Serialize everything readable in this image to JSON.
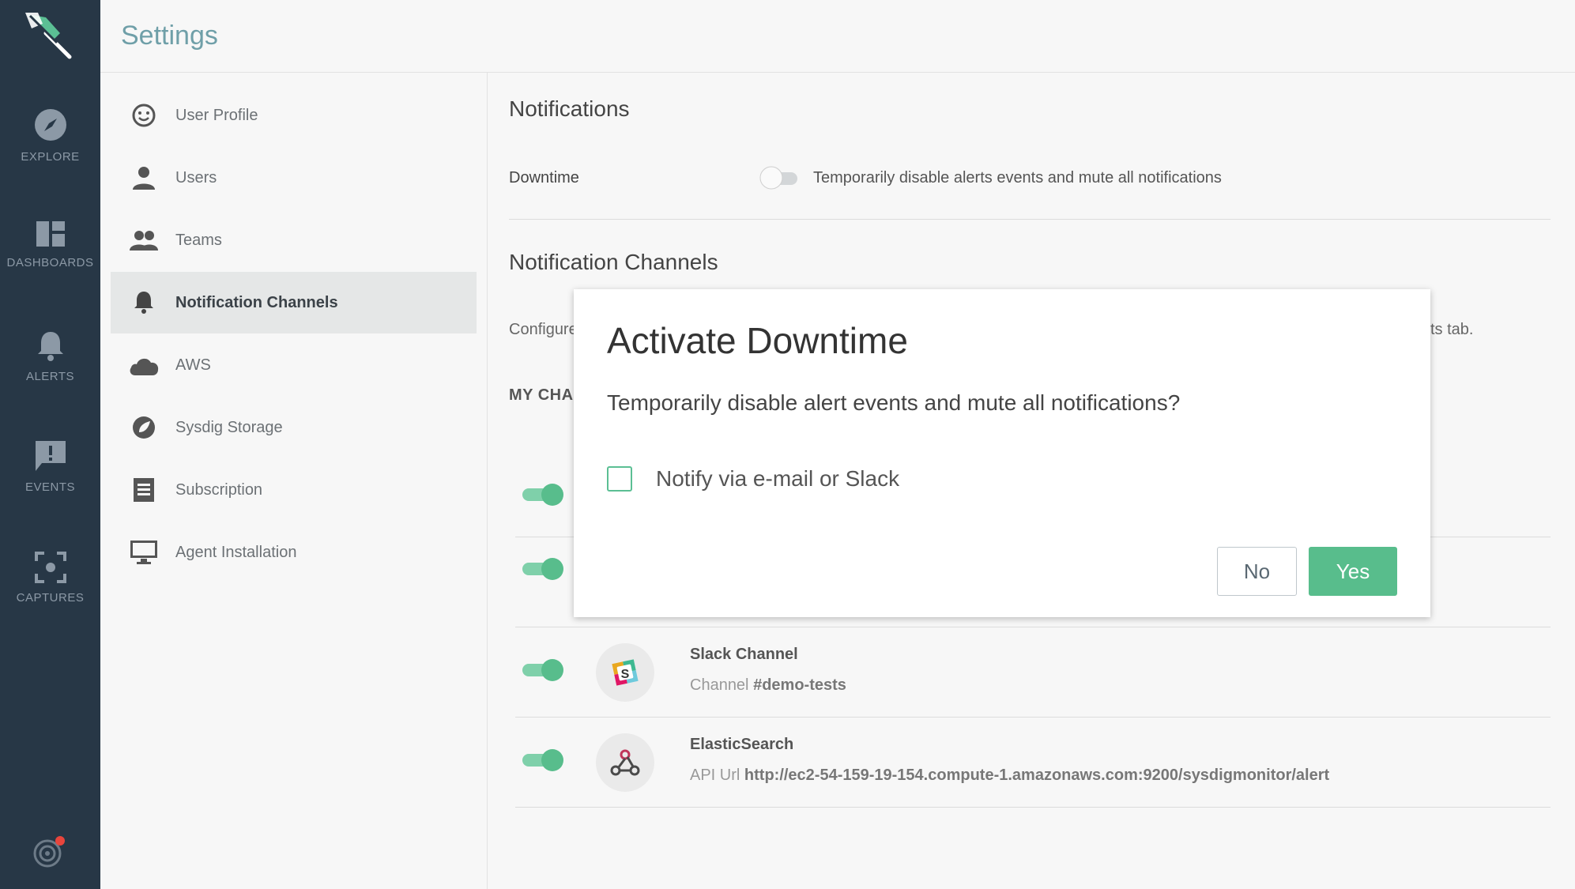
{
  "rail": {
    "items": [
      {
        "label": "EXPLORE",
        "icon": "compass-icon"
      },
      {
        "label": "DASHBOARDS",
        "icon": "dashboard-icon"
      },
      {
        "label": "ALERTS",
        "icon": "bell-icon"
      },
      {
        "label": "EVENTS",
        "icon": "exclamation-chat-icon"
      },
      {
        "label": "CAPTURES",
        "icon": "capture-icon"
      }
    ]
  },
  "header": {
    "title": "Settings"
  },
  "settings_nav": {
    "items": [
      {
        "label": "User Profile",
        "icon": "smiley-icon",
        "active": false
      },
      {
        "label": "Users",
        "icon": "person-icon",
        "active": false
      },
      {
        "label": "Teams",
        "icon": "people-icon",
        "active": false
      },
      {
        "label": "Notification Channels",
        "icon": "bell-icon",
        "active": true
      },
      {
        "label": "AWS",
        "icon": "cloud-icon",
        "active": false
      },
      {
        "label": "Sysdig Storage",
        "icon": "storage-icon",
        "active": false
      },
      {
        "label": "Subscription",
        "icon": "receipt-icon",
        "active": false
      },
      {
        "label": "Agent Installation",
        "icon": "monitor-icon",
        "active": false
      }
    ]
  },
  "main": {
    "notifications_title": "Notifications",
    "downtime_label": "Downtime",
    "downtime_desc": "Temporarily disable alerts events and mute all notifications",
    "channels_title": "Notification Channels",
    "configure_text": "Configure",
    "configure_tail": "ts tab.",
    "my_channels": "MY CHA",
    "channels": [
      {
        "name": "Slack Channel",
        "detail_label": "Channel",
        "detail_value": "#demo-tests",
        "icon": "slack-icon",
        "enabled": true
      },
      {
        "name": "ElasticSearch",
        "detail_label": "API Url",
        "detail_value": "http://ec2-54-159-19-154.compute-1.amazonaws.com:9200/sysdigmonitor/alert",
        "icon": "webhook-icon",
        "enabled": true
      }
    ]
  },
  "modal": {
    "title": "Activate Downtime",
    "message": "Temporarily disable alert events and mute all notifications?",
    "checkbox_label": "Notify via e-mail or Slack",
    "checkbox_checked": false,
    "no_label": "No",
    "yes_label": "Yes"
  },
  "colors": {
    "rail_bg": "#273746",
    "accent_green": "#58bd8c",
    "header_title": "#6f9fa8"
  }
}
